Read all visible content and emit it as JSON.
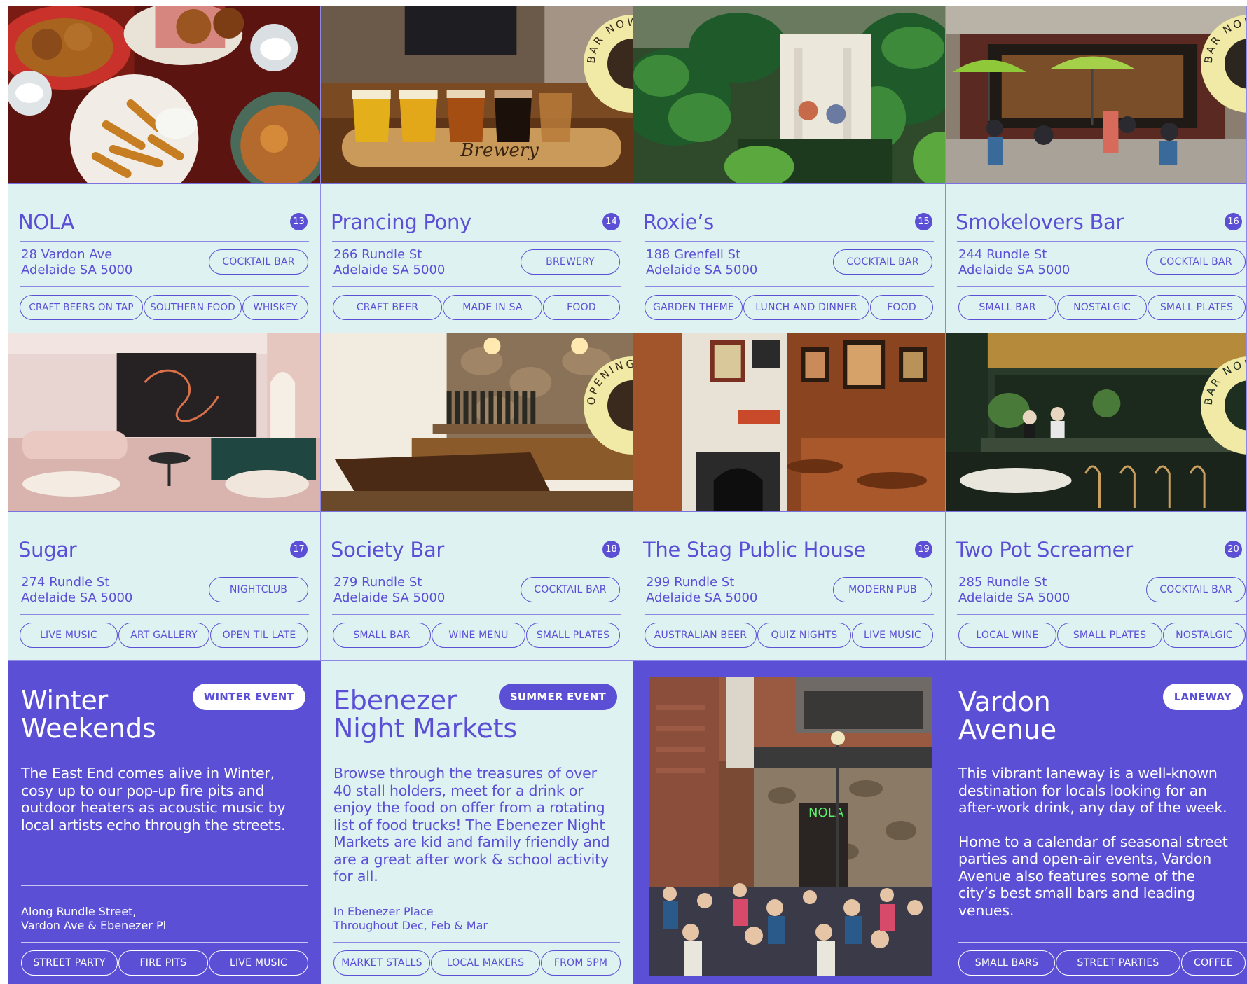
{
  "badges": {
    "bar_now_open": "BAR NOW OPEN",
    "opening_soon": "OPENING SOON"
  },
  "venues": [
    {
      "name": "NOLA",
      "number": "13",
      "address_line1": "28 Vardon Ave",
      "address_line2": "Adelaide SA 5000",
      "category": "COCKTAIL BAR",
      "tags": [
        "CRAFT BEERS ON TAP",
        "SOUTHERN FOOD",
        "WHISKEY"
      ]
    },
    {
      "name": "Prancing Pony",
      "number": "14",
      "address_line1": "266 Rundle St",
      "address_line2": "Adelaide SA 5000",
      "category": "BREWERY",
      "tags": [
        "CRAFT BEER",
        "MADE IN SA",
        "FOOD"
      ]
    },
    {
      "name": "Roxie’s",
      "number": "15",
      "address_line1": "188 Grenfell St",
      "address_line2": "Adelaide SA 5000",
      "category": "COCKTAIL BAR",
      "tags": [
        "GARDEN THEME",
        "LUNCH AND DINNER",
        "FOOD"
      ]
    },
    {
      "name": "Smokelovers Bar",
      "number": "16",
      "address_line1": "244 Rundle St",
      "address_line2": "Adelaide SA 5000",
      "category": "COCKTAIL BAR",
      "tags": [
        "SMALL BAR",
        "NOSTALGIC",
        "SMALL PLATES"
      ]
    },
    {
      "name": "Sugar",
      "number": "17",
      "address_line1": "274 Rundle St",
      "address_line2": "Adelaide SA 5000",
      "category": "NIGHTCLUB",
      "tags": [
        "LIVE MUSIC",
        "ART GALLERY",
        "OPEN TIL LATE"
      ]
    },
    {
      "name": "Society Bar",
      "number": "18",
      "address_line1": "279 Rundle St",
      "address_line2": "Adelaide SA 5000",
      "category": "COCKTAIL BAR",
      "tags": [
        "SMALL BAR",
        "WINE MENU",
        "SMALL PLATES"
      ]
    },
    {
      "name": "The Stag Public House",
      "number": "19",
      "address_line1": "299 Rundle St",
      "address_line2": "Adelaide SA 5000",
      "category": "MODERN PUB",
      "tags": [
        "AUSTRALIAN BEER",
        "QUIZ NIGHTS",
        "LIVE MUSIC"
      ]
    },
    {
      "name": "Two Pot Screamer",
      "number": "20",
      "address_line1": "285 Rundle St",
      "address_line2": "Adelaide SA 5000",
      "category": "COCKTAIL BAR",
      "tags": [
        "LOCAL WINE",
        "SMALL PLATES",
        "NOSTALGIC"
      ]
    }
  ],
  "events": [
    {
      "title_line1": "Winter",
      "title_line2": "Weekends",
      "badge": "WINTER EVENT",
      "body": "The East End comes alive in Winter, cosy up to our pop-up fire pits and outdoor heaters as acoustic music by local artists echo through the streets.",
      "location_line1": "Along Rundle Street,",
      "location_line2": "Vardon Ave & Ebenezer Pl",
      "tags": [
        "STREET PARTY",
        "FIRE PITS",
        "LIVE MUSIC"
      ]
    },
    {
      "title_line1": "Ebenezer",
      "title_line2": "Night Markets",
      "badge": "SUMMER EVENT",
      "body": "Browse through the treasures of over 40 stall holders, meet for a drink or enjoy the food on offer from a rotating list of food trucks! The Ebenezer Night Markets are kid and family friendly and are a great after work & school activity for all.",
      "location_line1": "In Ebenezer Place",
      "location_line2": "Throughout Dec, Feb & Mar",
      "tags": [
        "MARKET STALLS",
        "LOCAL MAKERS",
        "FROM 5PM"
      ]
    },
    {
      "sign_text": "NOLA"
    },
    {
      "title_line1": "Vardon",
      "title_line2": "Avenue",
      "badge": "LANEWAY",
      "body_p1": "This vibrant laneway is a well-known destination for locals looking for an after-work drink, any day of the week.",
      "body_p2": "Home to a calendar of seasonal street parties and open-air events, Vardon Avenue also features some of the city’s best small bars and leading venues.",
      "tags": [
        "SMALL BARS",
        "STREET PARTIES",
        "COFFEE"
      ]
    }
  ]
}
